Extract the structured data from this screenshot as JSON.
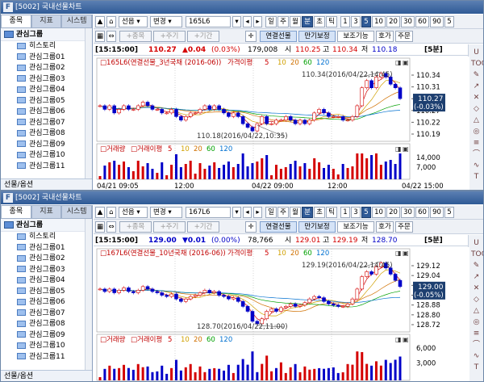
{
  "windows": [
    {
      "title": "[5002] 국내선물차트",
      "left_tabs": [
        "종목",
        "지표",
        "시스템"
      ],
      "tree_root": "관심그룹",
      "tree_items": [
        "히스토리",
        "관심그룹01",
        "관심그룹02",
        "관심그룹03",
        "관심그룹04",
        "관심그룹05",
        "관심그룹06",
        "관심그룹07",
        "관심그룹08",
        "관심그룹09",
        "관심그룹10",
        "관심그룹11"
      ],
      "tree_bottom": "선물/옵션",
      "toolbar": {
        "market": "선옵",
        "market2": "변경",
        "code": "165L6",
        "periods": [
          "일",
          "주",
          "월",
          "분",
          "초",
          "틱"
        ],
        "active_period": "분",
        "nums": [
          "1",
          "3",
          "5",
          "10",
          "20",
          "30",
          "60",
          "90",
          "5"
        ],
        "active_num": "5"
      },
      "toolbar2": {
        "btns": [
          "종목",
          "주기",
          "기간"
        ],
        "tools": [
          "연결선물",
          "만기보정",
          "보조기능",
          "호가",
          "주문"
        ]
      },
      "info": {
        "time": "[15:15:00]",
        "price": "110.27",
        "change": "▲0.04",
        "pct": "(0.03%)",
        "volume": "179,008",
        "open_lbl": "시",
        "open": "110.25",
        "high_lbl": "고",
        "high": "110.34",
        "low_lbl": "저",
        "low": "110.18",
        "interval": "[5분]"
      },
      "chart_legend": {
        "name": "165L6(연결선물_3년국채 (2016-06))",
        "ma": "가격이평",
        "ma_vals": [
          "5",
          "10",
          "20",
          "60",
          "120"
        ]
      },
      "vol_legend": {
        "name": "거래량",
        "ma": "거래이평",
        "ma_vals": [
          "5",
          "10",
          "20",
          "60",
          "120"
        ]
      },
      "annotations": {
        "high": "110.34(2016/04/22,14:45)",
        "low": "110.18(2016/04/22,10:35)"
      },
      "y_labels": [
        "110.34",
        "110.31",
        "110.28",
        "110.27",
        "110.22",
        "110.19"
      ],
      "price_box": {
        "price": "110.27",
        "change": "(-0.03%)"
      },
      "vol_labels": [
        "14,000",
        "7,000"
      ],
      "x_labels": [
        "04/21 09:05",
        "12:00",
        "04/22 09:00",
        "12:00",
        "04/22 15:00"
      ],
      "chart_data": {
        "type": "line",
        "title": "165L6(연결선물_3년국채 (2016-06))",
        "ylim": [
          110.16,
          110.36
        ],
        "values": [
          110.25,
          110.24,
          110.25,
          110.23,
          110.24,
          110.25,
          110.24,
          110.24,
          110.25,
          110.26,
          110.25,
          110.24,
          110.24,
          110.23,
          110.23,
          110.24,
          110.22,
          110.21,
          110.22,
          110.23,
          110.23,
          110.24,
          110.25,
          110.24,
          110.25,
          110.24,
          110.23,
          110.22,
          110.23,
          110.22,
          110.2,
          110.19,
          110.18,
          110.2,
          110.22,
          110.2,
          110.2,
          110.21,
          110.21,
          110.22,
          110.21,
          110.2,
          110.21,
          110.2,
          110.21,
          110.23,
          110.24,
          110.23,
          110.22,
          110.22,
          110.22,
          110.21,
          110.21,
          110.22,
          110.25,
          110.3,
          110.32,
          110.3,
          110.33,
          110.34,
          110.33,
          110.31,
          110.3,
          110.27
        ]
      }
    },
    {
      "title": "[5002] 국내선물차트",
      "left_tabs": [
        "종목",
        "지표",
        "시스템"
      ],
      "tree_root": "관심그룹",
      "tree_items": [
        "히스토리",
        "관심그룹01",
        "관심그룹02",
        "관심그룹03",
        "관심그룹04",
        "관심그룹05",
        "관심그룹06",
        "관심그룹07",
        "관심그룹08",
        "관심그룹09",
        "관심그룹10",
        "관심그룹11"
      ],
      "tree_bottom": "선물/옵션",
      "toolbar": {
        "market": "선옵",
        "market2": "변경",
        "code": "167L6",
        "periods": [
          "일",
          "주",
          "월",
          "분",
          "초",
          "틱"
        ],
        "active_period": "분",
        "nums": [
          "1",
          "3",
          "5",
          "10",
          "20",
          "30",
          "60",
          "90",
          "5"
        ],
        "active_num": "5"
      },
      "toolbar2": {
        "btns": [
          "종목",
          "주기",
          "기간"
        ],
        "tools": [
          "연결선물",
          "만기보정",
          "보조기능",
          "호가",
          "주문"
        ]
      },
      "info": {
        "time": "[15:15:00]",
        "price": "129.00",
        "change": "▼0.01",
        "pct": "(0.00%)",
        "volume": "78,766",
        "open_lbl": "시",
        "open": "129.01",
        "high_lbl": "고",
        "high": "129.19",
        "low_lbl": "저",
        "low": "128.70",
        "interval": "[5분]"
      },
      "chart_legend": {
        "name": "167L6(연결선물_10년국채 (2016-06))",
        "ma": "가격이평",
        "ma_vals": [
          "5",
          "10",
          "20",
          "60",
          "120"
        ]
      },
      "vol_legend": {
        "name": "거래량",
        "ma": "거래이평",
        "ma_vals": [
          "5",
          "10",
          "20",
          "60",
          "120"
        ]
      },
      "annotations": {
        "high": "129.19(2016/04/22,14:45)",
        "low": "128.70(2016/04/22,11:00)"
      },
      "y_labels": [
        "129.12",
        "129.04",
        "129.00",
        "128.96",
        "128.88",
        "128.80",
        "128.72"
      ],
      "price_box": {
        "price": "129.00",
        "change": "(-0.05%)"
      },
      "vol_labels": [
        "6,000",
        "3,000"
      ],
      "x_labels": [],
      "chart_data": {
        "type": "line",
        "title": "167L6(연결선물_10년국채 (2016-06))",
        "ylim": [
          128.66,
          129.24
        ],
        "values": [
          128.98,
          128.96,
          128.98,
          128.95,
          128.97,
          128.99,
          128.96,
          128.95,
          128.97,
          129.0,
          128.98,
          128.96,
          128.95,
          128.93,
          128.92,
          128.94,
          128.9,
          128.88,
          128.9,
          128.92,
          128.93,
          128.95,
          128.97,
          128.95,
          128.96,
          128.93,
          128.92,
          128.9,
          128.91,
          128.88,
          128.84,
          128.8,
          128.72,
          128.7,
          128.74,
          128.8,
          128.82,
          128.8,
          128.83,
          128.84,
          128.86,
          128.84,
          128.85,
          128.87,
          128.9,
          128.92,
          128.91,
          128.88,
          128.86,
          128.85,
          128.84,
          128.84,
          128.86,
          128.9,
          128.98,
          129.08,
          129.12,
          129.1,
          129.16,
          129.19,
          129.15,
          129.1,
          129.05,
          129.0
        ]
      }
    }
  ],
  "right_icons": [
    "U",
    "TOOL",
    "✎",
    "↗",
    "✕",
    "◇",
    "△",
    "◎",
    "≡",
    "⌒",
    "∿",
    "T"
  ],
  "colors": {
    "title": "#2f5a96",
    "up": "#d40000",
    "down": "#0000c8",
    "ma5": "#cc0000",
    "ma10": "#d0a000",
    "ma20": "#d07000",
    "ma60": "#00a000",
    "ma120": "#0070d0"
  }
}
